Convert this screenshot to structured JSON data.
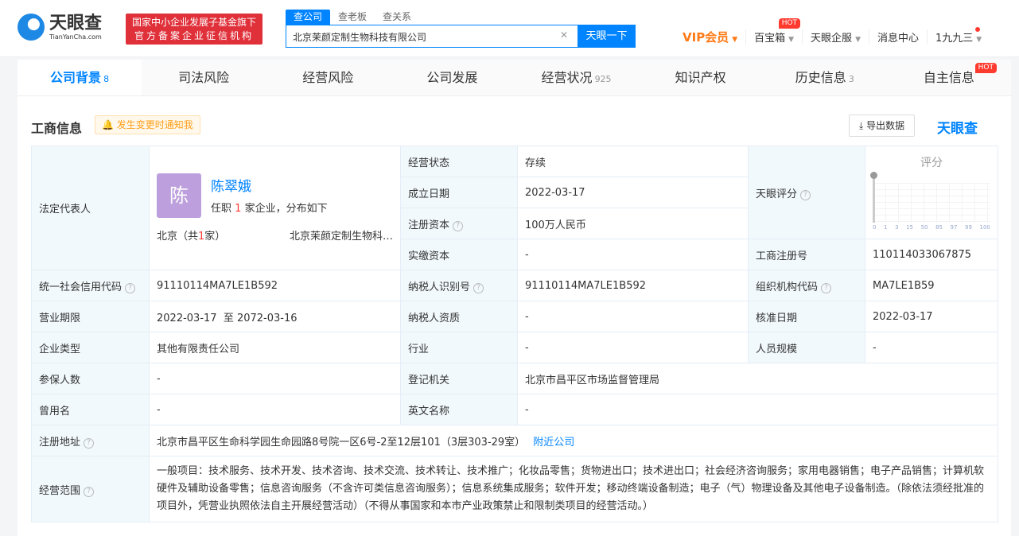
{
  "header": {
    "logo_cn": "天眼查",
    "logo_en": "TianYanCha.com",
    "badge_line1": "国家中小企业发展子基金旗下",
    "badge_line2": "官方备案企业征信机构",
    "search_tabs": [
      "查公司",
      "查老板",
      "查关系"
    ],
    "search_value": "北京茉颜定制生物科技有限公司",
    "search_button": "天眼一下",
    "nav": {
      "vip": "VIP会员",
      "toolbox": "百宝箱",
      "hot": "HOT",
      "service": "天眼企服",
      "messages": "消息中心",
      "user": "1九九三"
    }
  },
  "tabs": [
    {
      "label": "公司背景",
      "count": "8"
    },
    {
      "label": "司法风险",
      "count": ""
    },
    {
      "label": "经营风险",
      "count": ""
    },
    {
      "label": "公司发展",
      "count": ""
    },
    {
      "label": "经营状况",
      "count": "925"
    },
    {
      "label": "知识产权",
      "count": ""
    },
    {
      "label": "历史信息",
      "count": "3"
    },
    {
      "label": "自主信息",
      "count": "",
      "hot": "HOT"
    }
  ],
  "section": {
    "title": "工商信息",
    "notify": "发生变更时通知我",
    "export": "导出数据",
    "watermark": "天眼查"
  },
  "info": {
    "legal_rep_label": "法定代表人",
    "avatar_char": "陈",
    "rep_name": "陈翠娥",
    "rep_sub_pre": "任职",
    "rep_count": "1",
    "rep_sub_post": "家企业，分布如下",
    "rep_loc_pre": "北京（共",
    "rep_loc_count": "1",
    "rep_loc_post": "家）",
    "rep_company": "北京茉颜定制生物科…",
    "status_label": "经营状态",
    "status": "存续",
    "score_label": "天眼评分",
    "score_title": "评分",
    "score_scale": [
      "0",
      "1",
      "3",
      "15",
      "50",
      "85",
      "97",
      "99",
      "100"
    ],
    "founded_label": "成立日期",
    "founded": "2022-03-17",
    "capital_label": "注册资本",
    "capital": "100万人民币",
    "paid_label": "实缴资本",
    "paid": "-",
    "regno_label": "工商注册号",
    "regno": "110114033067875",
    "credit_label": "统一社会信用代码",
    "credit": "91110114MA7LE1B592",
    "taxid_label": "纳税人识别号",
    "taxid": "91110114MA7LE1B592",
    "org_label": "组织机构代码",
    "org": "MA7LE1B59",
    "term_label": "营业期限",
    "term": "2022-03-17  至 2072-03-16",
    "taxq_label": "纳税人资质",
    "taxq": "-",
    "approve_label": "核准日期",
    "approve": "2022-03-17",
    "type_label": "企业类型",
    "type": "其他有限责任公司",
    "industry_label": "行业",
    "industry": "-",
    "staff_label": "人员规模",
    "staff": "-",
    "insured_label": "参保人数",
    "insured": "-",
    "authority_label": "登记机关",
    "authority": "北京市昌平区市场监督管理局",
    "former_label": "曾用名",
    "former": "-",
    "en_label": "英文名称",
    "en": "-",
    "addr_label": "注册地址",
    "addr": "北京市昌平区生命科学园生命园路8号院一区6号-2至12层101（3层303-29室）",
    "nearby": "附近公司",
    "scope_label": "经营范围",
    "scope": "一般项目：技术服务、技术开发、技术咨询、技术交流、技术转让、技术推广；化妆品零售；货物进出口；技术进出口；社会经济咨询服务；家用电器销售；电子产品销售；计算机软硬件及辅助设备零售；信息咨询服务（不含许可类信息咨询服务）；信息系统集成服务；软件开发；移动终端设备制造；电子（气）物理设备及其他电子设备制造。（除依法须经批准的项目外，凭营业执照依法自主开展经营活动）（不得从事国家和本市产业政策禁止和限制类项目的经营活动。）"
  }
}
